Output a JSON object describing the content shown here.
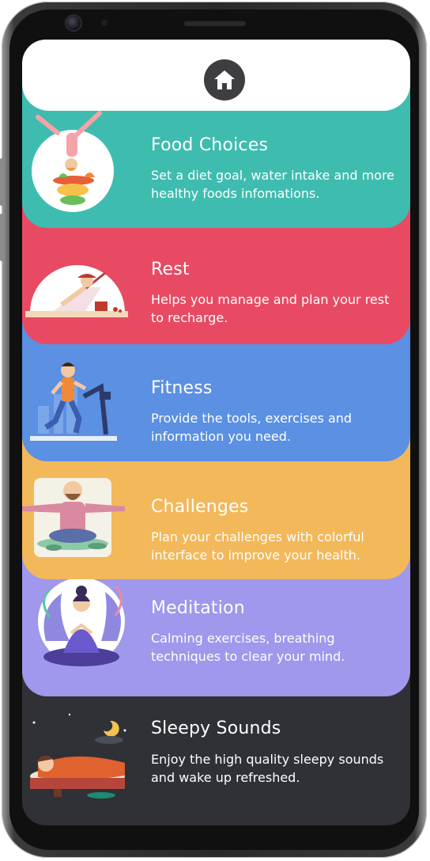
{
  "header": {
    "home_icon": "home-icon"
  },
  "features": [
    {
      "title": "Food Choices",
      "description": "Set a diet goal, water intake and more healthy foods infomations.",
      "color": "#3fbcb0",
      "icon": "food-choices-illustration"
    },
    {
      "title": "Rest",
      "description": "Helps you manage and plan your rest to recharge.",
      "color": "#e84a63",
      "icon": "rest-illustration"
    },
    {
      "title": "Fitness",
      "description": "Provide the tools, exercises and information you need.",
      "color": "#5b90e2",
      "icon": "fitness-illustration"
    },
    {
      "title": "Challenges",
      "description": "Plan your challenges with colorful interface to improve your health.",
      "color": "#f3b85a",
      "icon": "challenges-illustration"
    },
    {
      "title": "Meditation",
      "description": "Calming exercises, breathing techniques to clear your mind.",
      "color": "#9f98ec",
      "icon": "meditation-illustration"
    },
    {
      "title": "Sleepy Sounds",
      "description": "Enjoy the high quality sleepy sounds and wake up refreshed.",
      "color": "#2f3136",
      "icon": "sleepy-sounds-illustration"
    }
  ]
}
